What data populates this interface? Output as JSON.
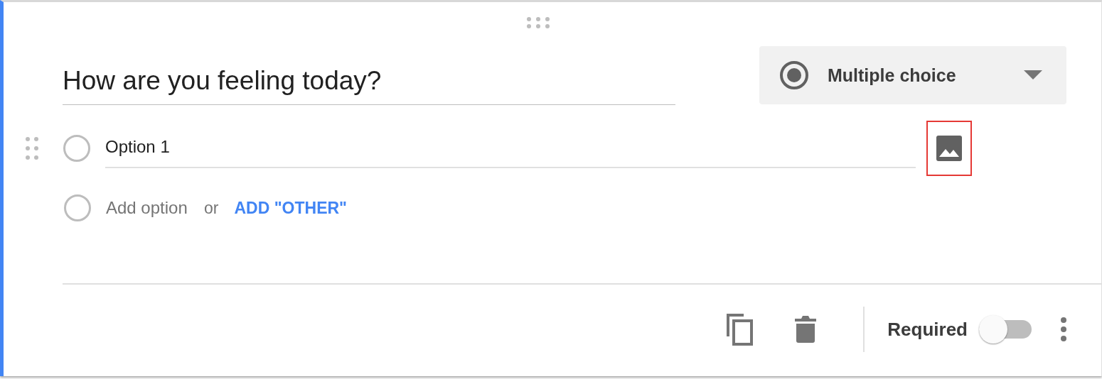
{
  "question": {
    "title": "How are you feeling today?"
  },
  "type_dropdown": {
    "label": "Multiple choice"
  },
  "options": [
    {
      "label": "Option 1",
      "image_button_highlighted": true
    }
  ],
  "add_option": {
    "placeholder": "Add option",
    "separator": "or",
    "other_link": "ADD \"OTHER\""
  },
  "footer": {
    "required_label": "Required",
    "required_on": false
  }
}
